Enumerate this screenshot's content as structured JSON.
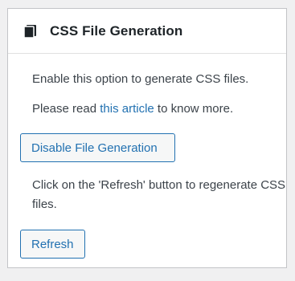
{
  "header": {
    "icon": "book-icon",
    "title": "CSS File Generation"
  },
  "body": {
    "description": "Enable this option to generate CSS files.",
    "read_prefix": "Please read ",
    "read_link": "this article",
    "read_suffix": " to know more.",
    "disable_button_label": "Disable File Generation",
    "refresh_instruction": "Click on the 'Refresh' button to regenerate CSS files.",
    "refresh_button_label": "Refresh"
  },
  "colors": {
    "link": "#2271b1",
    "button_border": "#2271b1",
    "text": "#3c434a",
    "title": "#1d2327"
  }
}
